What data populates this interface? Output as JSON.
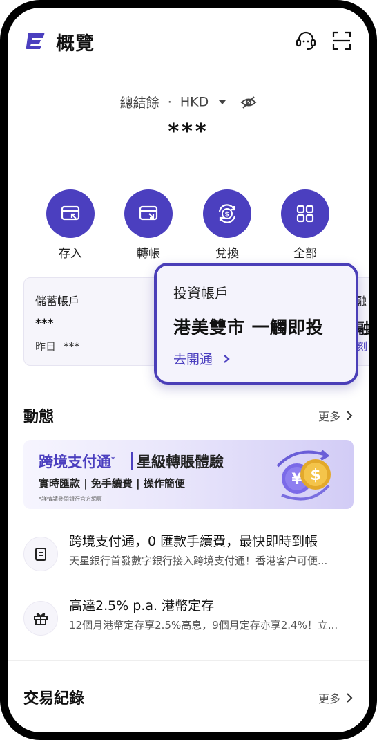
{
  "header": {
    "title": "概覽",
    "icons": [
      "logo-icon",
      "headset-icon",
      "scan-icon"
    ]
  },
  "balance": {
    "label": "總結餘",
    "separator": "·",
    "currency": "HKD",
    "value": "***"
  },
  "actions": [
    {
      "label": "存入",
      "icon": "deposit-icon"
    },
    {
      "label": "轉帳",
      "icon": "transfer-icon"
    },
    {
      "label": "兌換",
      "icon": "exchange-icon"
    },
    {
      "label": "全部",
      "icon": "grid-icon"
    }
  ],
  "cards": {
    "savings": {
      "title": "儲蓄帳戶",
      "value": "***",
      "sub_label": "昨日",
      "sub_value": "***"
    },
    "partial_right": {
      "title": "融",
      "line2": "融資",
      "link": "刻"
    }
  },
  "popup": {
    "title": "投資帳戶",
    "headline": "港美雙市 一觸即投",
    "link": "去開通"
  },
  "activity": {
    "title": "動態",
    "more": "更多"
  },
  "banner": {
    "title_left": "跨境支付通",
    "title_mark": "*",
    "title_right": "星級轉賬體驗",
    "features": "實時匯款 | 免手續費 | 操作簡便",
    "footnote": "*詳情請參閱銀行官方網頁"
  },
  "news": [
    {
      "title": "跨境支付通，0 匯款手續費，最快即時到帳",
      "subtitle": "天星銀行首發數字銀行接入跨境支付通！香港客户可便...",
      "icon": "document-icon"
    },
    {
      "title": "高達2.5% p.a. 港幣定存",
      "subtitle": "12個月港幣定存享2.5%高息，9個月定存亦享2.4%！立...",
      "icon": "gift-icon"
    }
  ],
  "transactions": {
    "title": "交易紀錄",
    "more": "更多"
  },
  "colors": {
    "accent": "#4b3fbf",
    "card_bg": "#f6f5fb",
    "popup_border": "#4a3eb8"
  }
}
